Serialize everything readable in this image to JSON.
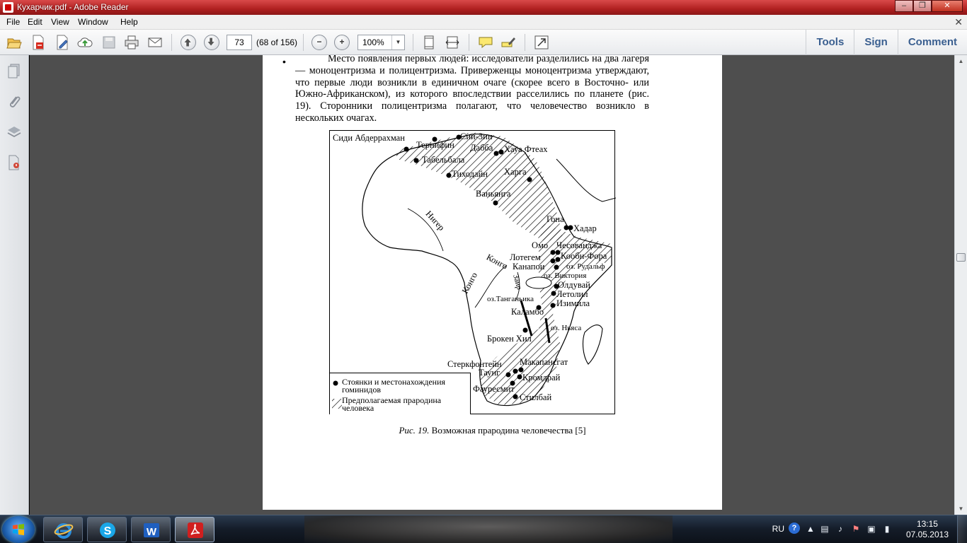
{
  "window": {
    "title": "Кухарчик.pdf - Adobe Reader",
    "minimize": "–",
    "maximize": "❐",
    "close": "✕"
  },
  "menu": {
    "items": [
      "File",
      "Edit",
      "View",
      "Window",
      "Help"
    ],
    "close_doc": "✕"
  },
  "toolbar": {
    "page_number": "73",
    "page_count": "(68 of 156)",
    "zoom_out": "−",
    "zoom_in": "+",
    "zoom": "100%",
    "right_links": [
      "Tools",
      "Sign",
      "Comment"
    ]
  },
  "document": {
    "paragraph": "Место появления первых людей: исследователи разделились на два лагеря — моноцентризма и полицентризма. Приверженцы моноцентризма утверждают, что первые люди возникли в единичном очаге (скорее всего в Восточно- или Южно-Африканском), из которого впоследствии расселились по планете (рис. 19). Сторонники полицентризма полагают, что человечество возникло в нескольких очагах.",
    "map_labels": {
      "sidi": "Сиди Абдеррахман",
      "sizin": "Сии-Зин",
      "ternifin": "Тернифин",
      "dabba": "Дабба",
      "haua": "Хауа Фтеах",
      "tabelbala": "Табельбала",
      "tihodain": "Тиходайн",
      "harga": "Харга",
      "vanyanga": "Ваньянга",
      "niger": "Нигер",
      "gona": "Гона",
      "hadar": "Хадар",
      "omo": "Омо",
      "chesovanja": "Чесованджа",
      "lotegem": "Лотегем",
      "koobi": "Кообн-Фора",
      "kongo1": "Конго",
      "kanapoi": "Канапои",
      "rudolf": "оз. Рудальф",
      "kongo2": "Конго",
      "zair": "Заир",
      "victoria": "оз. Виктория",
      "olduvai": "Олдувай",
      "letolil": "Летолил",
      "tanganika": "оз.Танганьика",
      "izimila": "Изимила",
      "kalambo": "Каламбо",
      "nyasa": "оз. Ньяса",
      "broken": "Брокен Хил",
      "sterk": "Стеркфонтейн",
      "makapan": "Макапансгат",
      "taung": "Таунг",
      "kromdrai": "Кромдрай",
      "fauresmit": "Фауресмит",
      "stilbai": "Стилбай"
    },
    "legend": {
      "sites_line1": "Стоянки и местонахождения",
      "sites_line2": "гоминидов",
      "homeland_line1": "Предполагаемая прародина",
      "homeland_line2": "человека"
    },
    "caption_num": "Рис. 19.",
    "caption_text": " Возможная прародина человечества [5]"
  },
  "taskbar": {
    "lang": "RU",
    "help": "?",
    "time": "13:15",
    "date": "07.05.2013"
  },
  "colors": {
    "title_red": "#b02020",
    "link_blue": "#3a5f90",
    "doc_bg": "#4e4e4e"
  }
}
